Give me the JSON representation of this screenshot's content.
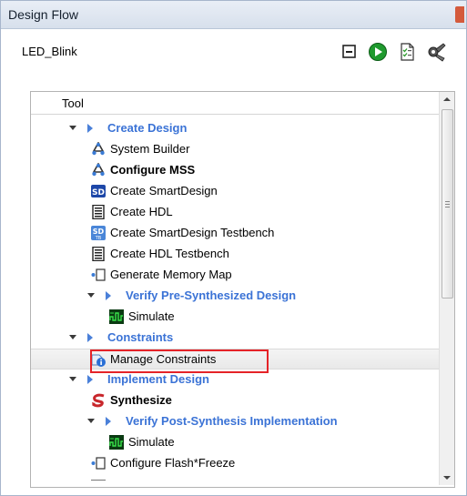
{
  "window": {
    "title": "Design Flow"
  },
  "toolbar": {
    "project_name": "LED_Blink",
    "icons": [
      "collapse-all-icon",
      "run-icon",
      "report-icon",
      "settings-icon"
    ]
  },
  "tree": {
    "column_header": "Tool",
    "rows": [
      {
        "label": "Create Design",
        "style": "group",
        "check": true
      },
      {
        "label": "System Builder",
        "style": "normal"
      },
      {
        "label": "Configure MSS",
        "style": "bold",
        "check": true
      },
      {
        "label": "Create SmartDesign",
        "style": "normal"
      },
      {
        "label": "Create HDL",
        "style": "normal"
      },
      {
        "label": "Create SmartDesign Testbench",
        "style": "normal"
      },
      {
        "label": "Create HDL Testbench",
        "style": "normal"
      },
      {
        "label": "Generate Memory Map",
        "style": "normal"
      },
      {
        "label": "Verify Pre-Synthesized Design",
        "style": "group"
      },
      {
        "label": "Simulate",
        "style": "normal"
      },
      {
        "label": "Constraints",
        "style": "group"
      },
      {
        "label": "Manage Constraints",
        "style": "normal",
        "selected": true
      },
      {
        "label": "Implement Design",
        "style": "group"
      },
      {
        "label": "Synthesize",
        "style": "bold",
        "check": true
      },
      {
        "label": "Verify Post-Synthesis Implementation",
        "style": "group"
      },
      {
        "label": "Simulate",
        "style": "normal"
      },
      {
        "label": "Configure Flash*Freeze",
        "style": "normal"
      }
    ]
  },
  "colors": {
    "group_text": "#3b73d6",
    "check_green": "#2e8b1e",
    "highlight": "#e52328"
  }
}
